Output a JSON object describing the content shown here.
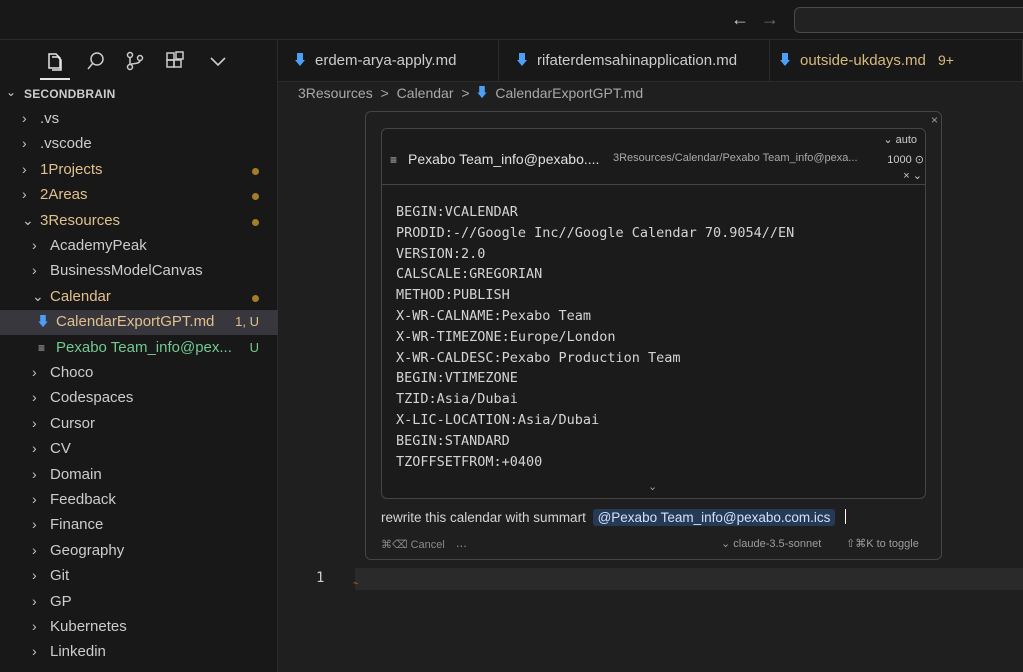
{
  "titlebar": {
    "back": "←",
    "forward": "→",
    "command_center": ""
  },
  "activity": {
    "files": "files-icon",
    "search": "search-icon",
    "scm": "source-control-icon",
    "extensions": "extensions-icon",
    "more": "chevron-down-icon"
  },
  "explorer": {
    "root": "SECONDBRAIN",
    "items": [
      {
        "label": ".vs",
        "chevron": "›",
        "color": "white"
      },
      {
        "label": ".vscode",
        "chevron": "›",
        "color": "white"
      },
      {
        "label": "1Projects",
        "chevron": "›",
        "color": "yellow",
        "dot": true
      },
      {
        "label": "2Areas",
        "chevron": "›",
        "color": "yellow",
        "dot": true
      },
      {
        "label": "3Resources",
        "chevron": "⌄",
        "color": "yellow",
        "dot": true
      },
      {
        "label": "AcademyPeak",
        "chevron": "›",
        "color": "white"
      },
      {
        "label": "BusinessModelCanvas",
        "chevron": "›",
        "color": "white"
      },
      {
        "label": "Calendar",
        "chevron": "⌄",
        "color": "yellow",
        "dot": true
      },
      {
        "label": "CalendarExportGPT.md",
        "badge": "1, U",
        "color": "yellow"
      },
      {
        "label": "Pexabo Team_info@pex...",
        "badge": "U",
        "color": "green"
      },
      {
        "label": "Choco",
        "chevron": "›",
        "color": "white"
      },
      {
        "label": "Codespaces",
        "chevron": "›",
        "color": "white"
      },
      {
        "label": "Cursor",
        "chevron": "›",
        "color": "white"
      },
      {
        "label": "CV",
        "chevron": "›",
        "color": "white"
      },
      {
        "label": "Domain",
        "chevron": "›",
        "color": "white"
      },
      {
        "label": "Feedback",
        "chevron": "›",
        "color": "white"
      },
      {
        "label": "Finance",
        "chevron": "›",
        "color": "white"
      },
      {
        "label": "Geography",
        "chevron": "›",
        "color": "white"
      },
      {
        "label": "Git",
        "chevron": "›",
        "color": "white"
      },
      {
        "label": "GP",
        "chevron": "›",
        "color": "white"
      },
      {
        "label": "Kubernetes",
        "chevron": "›",
        "color": "white"
      },
      {
        "label": "Linkedin",
        "chevron": "›",
        "color": "white"
      }
    ]
  },
  "tabs": [
    {
      "label": "erdem-arya-apply.md",
      "badge": ""
    },
    {
      "label": "rifaterdemsahinapplication.md",
      "badge": ""
    },
    {
      "label": "outside-ukdays.md",
      "badge": "9+"
    }
  ],
  "breadcrumb": {
    "part1": "3Resources",
    "sep": ">",
    "part2": "Calendar",
    "part3": "CalendarExportGPT.md"
  },
  "chat": {
    "close": "×",
    "attachment": {
      "title": "Pexabo Team_info@pexabo....",
      "path": "3Resources/Calendar/Pexabo Team_info@pexa...",
      "auto": "⌄ auto",
      "count": "1000 ⊙",
      "actions": "× ⌄",
      "lines": [
        "BEGIN:VCALENDAR",
        "PRODID:-//Google Inc//Google Calendar 70.9054//EN",
        "VERSION:2.0",
        "CALSCALE:GREGORIAN",
        "METHOD:PUBLISH",
        "X-WR-CALNAME:Pexabo Team",
        "X-WR-TIMEZONE:Europe/London",
        "X-WR-CALDESC:Pexabo Production Team",
        "BEGIN:VTIMEZONE",
        "TZID:Asia/Dubai",
        "X-LIC-LOCATION:Asia/Dubai",
        "BEGIN:STANDARD",
        "TZOFFSETFROM:+0400"
      ],
      "expand": "⌄"
    },
    "prompt_text": "rewrite this calendar with summart",
    "mention": "@Pexabo Team_info@pexabo.com.ics",
    "cancel": "⌘⌫ Cancel",
    "more": "...",
    "model": "⌄ claude-3.5-sonnet",
    "toggle": "⇧⌘K to toggle"
  },
  "editor": {
    "line_number": "1",
    "squiggle": "~"
  },
  "colors": {
    "background": "#1f1f1f",
    "sidebar": "#181818",
    "yellow": "#e2c08d",
    "green": "#73c991",
    "markdown_icon": "#4d9ef5"
  }
}
